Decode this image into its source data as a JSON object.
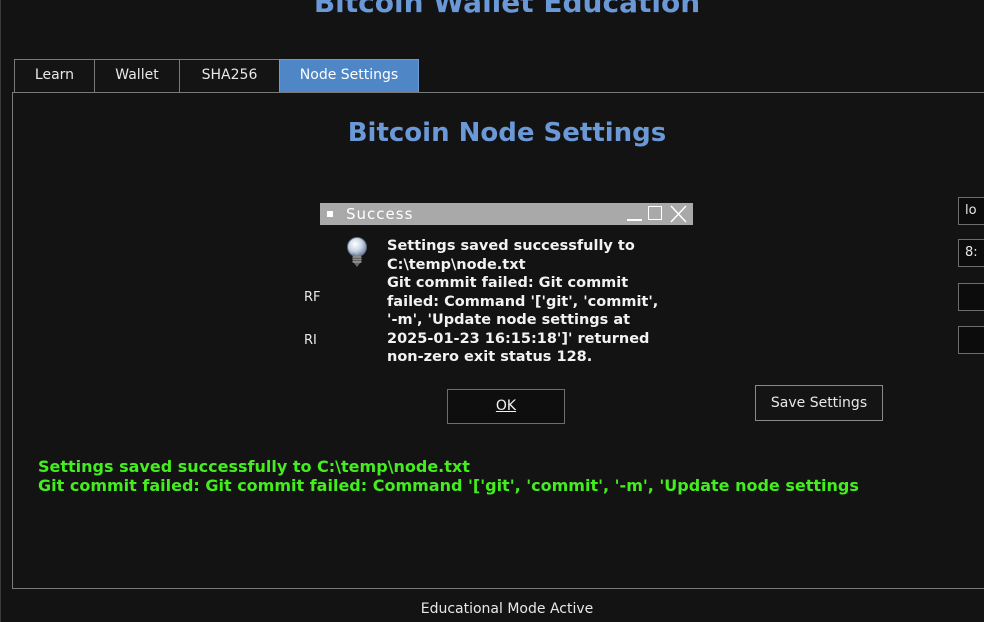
{
  "app": {
    "title": "Bitcoin Wallet Education"
  },
  "tabs": [
    {
      "label": "Learn"
    },
    {
      "label": "Wallet"
    },
    {
      "label": "SHA256"
    },
    {
      "label": "Node Settings",
      "active": true
    }
  ],
  "main": {
    "title": "Bitcoin Node Settings",
    "fields": [
      {
        "value": "lo"
      },
      {
        "value": "8:"
      },
      {
        "value": ""
      },
      {
        "value": ""
      }
    ],
    "row_labels": [
      "RF",
      "RI"
    ],
    "save_label": "Save Settings",
    "status_message": "Settings saved successfully to C:\\temp\\node.txt\nGit commit failed: Git commit failed: Command '['git', 'commit', '-m', 'Update node settings"
  },
  "dialog": {
    "title": "Success",
    "message": "Settings saved successfully to\nC:\\temp\\node.txt\nGit commit failed: Git commit\nfailed: Command '['git', 'commit',\n'-m', 'Update node settings at\n2025-01-23 16:15:18']' returned\nnon-zero exit status 128.",
    "ok_label": "OK",
    "icon": "lightbulb-icon"
  },
  "footer": {
    "status": "Educational Mode Active"
  },
  "colors": {
    "accent": "#6b98d6",
    "active_tab": "#4f86c6",
    "status_green": "#44ee1e",
    "titlebar": "#a9a9a9"
  }
}
